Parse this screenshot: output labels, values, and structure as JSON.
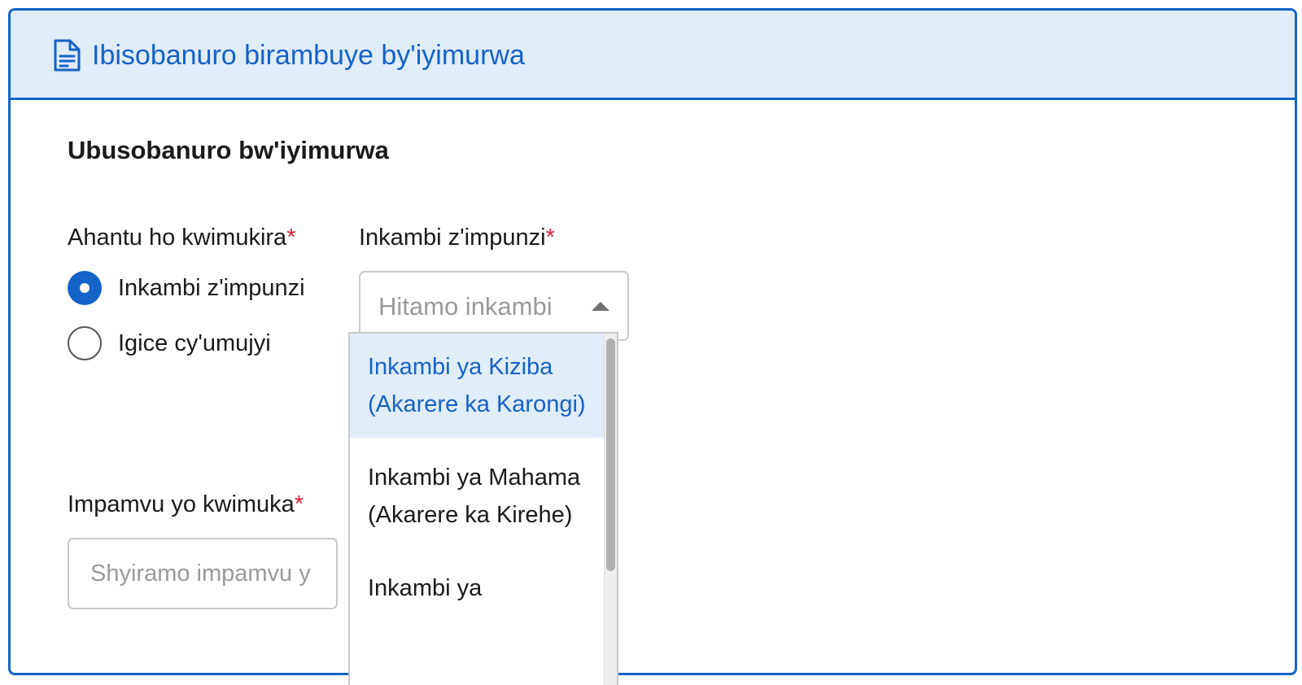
{
  "header": {
    "icon": "document-icon",
    "title": "Ibisobanuro birambuye by'iyimurwa"
  },
  "section": {
    "title": "Ubusobanuro bw'iyimurwa"
  },
  "location": {
    "label": "Ahantu ho kwimukira",
    "required_mark": "*",
    "options": [
      {
        "label": "Inkambi z'impunzi",
        "selected": true
      },
      {
        "label": "Igice cy'umujyi",
        "selected": false
      }
    ]
  },
  "camp": {
    "label": "Inkambi z'impunzi",
    "required_mark": "*",
    "placeholder": "Hitamo inkambi",
    "dropdown_open": true,
    "options": [
      {
        "label": "Inkambi ya Kiziba (Akarere ka Karongi)",
        "highlighted": true
      },
      {
        "label": "Inkambi ya Mahama (Akarere ka Kirehe)",
        "highlighted": false
      },
      {
        "label": "Inkambi ya",
        "highlighted": false
      }
    ]
  },
  "reason": {
    "label": "Impamvu yo kwimuka",
    "required_mark": "*",
    "placeholder": "Shyiramo impamvu y",
    "value": ""
  },
  "colors": {
    "accent": "#1463c7",
    "header_bg": "#e0ecf8",
    "required": "#e0203b"
  }
}
